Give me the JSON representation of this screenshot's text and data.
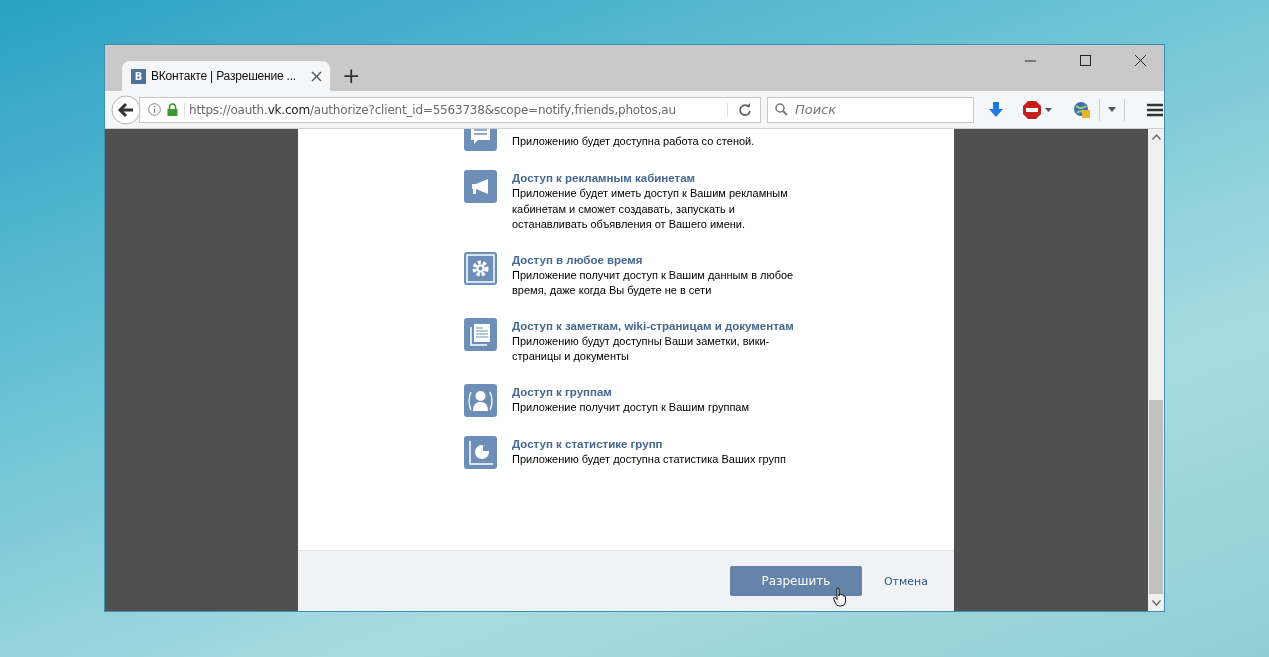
{
  "tab": {
    "favicon_letter": "В",
    "title": "ВКонтакте | Разрешение ...",
    "new_tab": "+"
  },
  "address": {
    "scheme": "https://oauth.",
    "host": "vk.com",
    "path": "/authorize?client_id=5563738&scope=notify,friends,photos,au"
  },
  "search": {
    "placeholder": "Поиск"
  },
  "permissions": [
    {
      "kind": "wall",
      "description": "Приложению будет доступна работа со стеной."
    },
    {
      "kind": "ads",
      "title": "Доступ к рекламным кабинетам",
      "description": "Приложение будет иметь доступ к Вашим рекламным кабинетам и сможет создавать, запускать и останавливать объявления от Вашего имени."
    },
    {
      "kind": "gear",
      "title": "Доступ в любое время",
      "description": "Приложение получит доступ к Вашим данным в любое время, даже когда Вы будете не в сети"
    },
    {
      "kind": "docs",
      "title": "Доступ к заметкам, wiki-страницам и документам",
      "description": "Приложению будут доступны Ваши заметки, вики-страницы и документы"
    },
    {
      "kind": "groups",
      "title": "Доступ к группам",
      "description": "Приложение получит доступ к Вашим группам"
    },
    {
      "kind": "stats",
      "title": "Доступ к статистике групп",
      "description": "Приложению будет доступна статистика Ваших групп"
    }
  ],
  "buttons": {
    "allow": "Разрешить",
    "cancel": "Отмена"
  }
}
